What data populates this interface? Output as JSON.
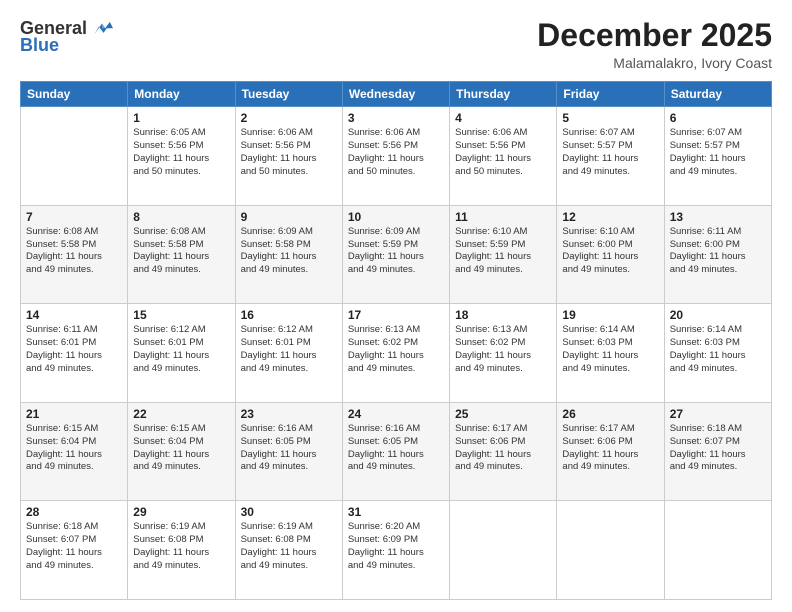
{
  "header": {
    "logo_general": "General",
    "logo_blue": "Blue",
    "month_title": "December 2025",
    "location": "Malamalakro, Ivory Coast"
  },
  "weekdays": [
    "Sunday",
    "Monday",
    "Tuesday",
    "Wednesday",
    "Thursday",
    "Friday",
    "Saturday"
  ],
  "weeks": [
    [
      {
        "day": "",
        "info": ""
      },
      {
        "day": "1",
        "info": "Sunrise: 6:05 AM\nSunset: 5:56 PM\nDaylight: 11 hours\nand 50 minutes."
      },
      {
        "day": "2",
        "info": "Sunrise: 6:06 AM\nSunset: 5:56 PM\nDaylight: 11 hours\nand 50 minutes."
      },
      {
        "day": "3",
        "info": "Sunrise: 6:06 AM\nSunset: 5:56 PM\nDaylight: 11 hours\nand 50 minutes."
      },
      {
        "day": "4",
        "info": "Sunrise: 6:06 AM\nSunset: 5:56 PM\nDaylight: 11 hours\nand 50 minutes."
      },
      {
        "day": "5",
        "info": "Sunrise: 6:07 AM\nSunset: 5:57 PM\nDaylight: 11 hours\nand 49 minutes."
      },
      {
        "day": "6",
        "info": "Sunrise: 6:07 AM\nSunset: 5:57 PM\nDaylight: 11 hours\nand 49 minutes."
      }
    ],
    [
      {
        "day": "7",
        "info": "Sunrise: 6:08 AM\nSunset: 5:58 PM\nDaylight: 11 hours\nand 49 minutes."
      },
      {
        "day": "8",
        "info": "Sunrise: 6:08 AM\nSunset: 5:58 PM\nDaylight: 11 hours\nand 49 minutes."
      },
      {
        "day": "9",
        "info": "Sunrise: 6:09 AM\nSunset: 5:58 PM\nDaylight: 11 hours\nand 49 minutes."
      },
      {
        "day": "10",
        "info": "Sunrise: 6:09 AM\nSunset: 5:59 PM\nDaylight: 11 hours\nand 49 minutes."
      },
      {
        "day": "11",
        "info": "Sunrise: 6:10 AM\nSunset: 5:59 PM\nDaylight: 11 hours\nand 49 minutes."
      },
      {
        "day": "12",
        "info": "Sunrise: 6:10 AM\nSunset: 6:00 PM\nDaylight: 11 hours\nand 49 minutes."
      },
      {
        "day": "13",
        "info": "Sunrise: 6:11 AM\nSunset: 6:00 PM\nDaylight: 11 hours\nand 49 minutes."
      }
    ],
    [
      {
        "day": "14",
        "info": "Sunrise: 6:11 AM\nSunset: 6:01 PM\nDaylight: 11 hours\nand 49 minutes."
      },
      {
        "day": "15",
        "info": "Sunrise: 6:12 AM\nSunset: 6:01 PM\nDaylight: 11 hours\nand 49 minutes."
      },
      {
        "day": "16",
        "info": "Sunrise: 6:12 AM\nSunset: 6:01 PM\nDaylight: 11 hours\nand 49 minutes."
      },
      {
        "day": "17",
        "info": "Sunrise: 6:13 AM\nSunset: 6:02 PM\nDaylight: 11 hours\nand 49 minutes."
      },
      {
        "day": "18",
        "info": "Sunrise: 6:13 AM\nSunset: 6:02 PM\nDaylight: 11 hours\nand 49 minutes."
      },
      {
        "day": "19",
        "info": "Sunrise: 6:14 AM\nSunset: 6:03 PM\nDaylight: 11 hours\nand 49 minutes."
      },
      {
        "day": "20",
        "info": "Sunrise: 6:14 AM\nSunset: 6:03 PM\nDaylight: 11 hours\nand 49 minutes."
      }
    ],
    [
      {
        "day": "21",
        "info": "Sunrise: 6:15 AM\nSunset: 6:04 PM\nDaylight: 11 hours\nand 49 minutes."
      },
      {
        "day": "22",
        "info": "Sunrise: 6:15 AM\nSunset: 6:04 PM\nDaylight: 11 hours\nand 49 minutes."
      },
      {
        "day": "23",
        "info": "Sunrise: 6:16 AM\nSunset: 6:05 PM\nDaylight: 11 hours\nand 49 minutes."
      },
      {
        "day": "24",
        "info": "Sunrise: 6:16 AM\nSunset: 6:05 PM\nDaylight: 11 hours\nand 49 minutes."
      },
      {
        "day": "25",
        "info": "Sunrise: 6:17 AM\nSunset: 6:06 PM\nDaylight: 11 hours\nand 49 minutes."
      },
      {
        "day": "26",
        "info": "Sunrise: 6:17 AM\nSunset: 6:06 PM\nDaylight: 11 hours\nand 49 minutes."
      },
      {
        "day": "27",
        "info": "Sunrise: 6:18 AM\nSunset: 6:07 PM\nDaylight: 11 hours\nand 49 minutes."
      }
    ],
    [
      {
        "day": "28",
        "info": "Sunrise: 6:18 AM\nSunset: 6:07 PM\nDaylight: 11 hours\nand 49 minutes."
      },
      {
        "day": "29",
        "info": "Sunrise: 6:19 AM\nSunset: 6:08 PM\nDaylight: 11 hours\nand 49 minutes."
      },
      {
        "day": "30",
        "info": "Sunrise: 6:19 AM\nSunset: 6:08 PM\nDaylight: 11 hours\nand 49 minutes."
      },
      {
        "day": "31",
        "info": "Sunrise: 6:20 AM\nSunset: 6:09 PM\nDaylight: 11 hours\nand 49 minutes."
      },
      {
        "day": "",
        "info": ""
      },
      {
        "day": "",
        "info": ""
      },
      {
        "day": "",
        "info": ""
      }
    ]
  ]
}
